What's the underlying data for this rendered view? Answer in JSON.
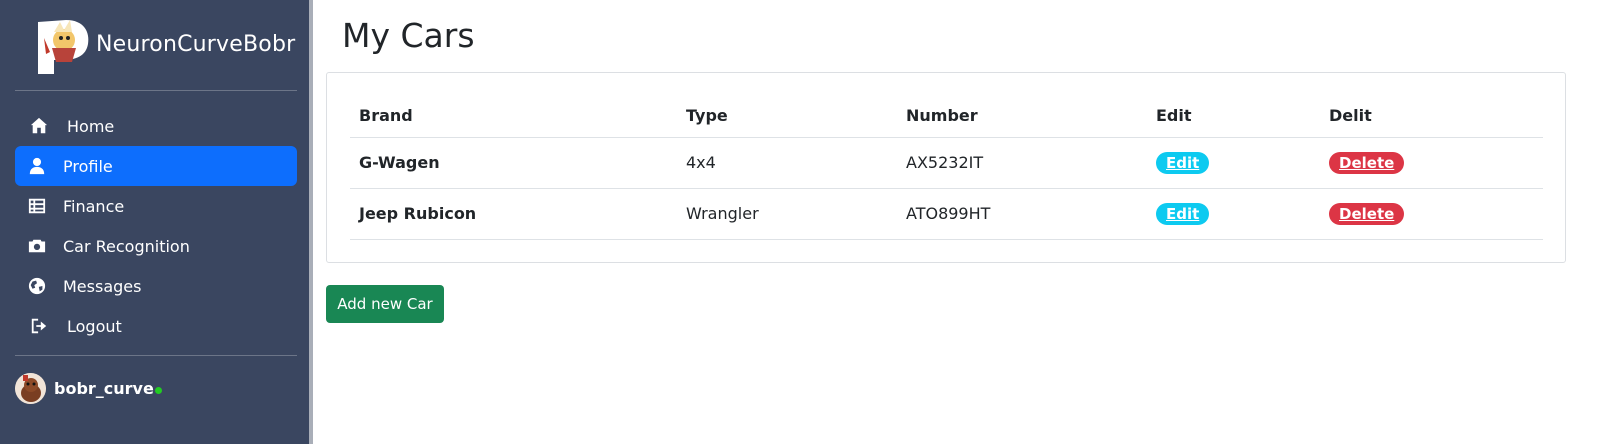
{
  "app": {
    "brand_name": "NeuronCurveBobr"
  },
  "sidebar": {
    "items": [
      {
        "label": "Home",
        "icon": "home-icon",
        "active": false
      },
      {
        "label": "Profile",
        "icon": "user-icon",
        "active": true
      },
      {
        "label": "Finance",
        "icon": "table-icon",
        "active": false
      },
      {
        "label": "Car Recognition",
        "icon": "camera-icon",
        "active": false
      },
      {
        "label": "Messages",
        "icon": "globe-icon",
        "active": false
      },
      {
        "label": "Logout",
        "icon": "logout-icon",
        "active": false
      }
    ],
    "user": {
      "name": "bobr_curve",
      "status": "online"
    }
  },
  "main": {
    "title": "My Cars",
    "table": {
      "headers": [
        "Brand",
        "Type",
        "Number",
        "Edit",
        "Delit"
      ],
      "rows": [
        {
          "brand": "G-Wagen",
          "type": "4x4",
          "number": "AX5232IT",
          "edit": "Edit",
          "delete": "Delete"
        },
        {
          "brand": "Jeep Rubicon",
          "type": "Wrangler",
          "number": "ATO899HT",
          "edit": "Edit",
          "delete": "Delete"
        }
      ]
    },
    "add_button": "Add new Car"
  },
  "colors": {
    "sidebar_bg": "#3a4660",
    "active": "#0d6efd",
    "edit": "#0dcaf0",
    "delete": "#dc3545",
    "add": "#198754",
    "status_online": "#22cc22"
  }
}
